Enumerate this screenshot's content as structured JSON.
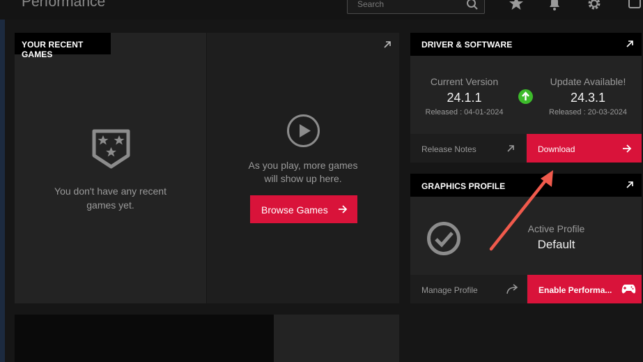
{
  "page": {
    "title": "Performance"
  },
  "search": {
    "placeholder": "Search"
  },
  "recent_games": {
    "header": "YOUR RECENT GAMES",
    "empty_text_line1": "You don't have any recent",
    "empty_text_line2": "games yet.",
    "prompt_line1": "As you play, more games",
    "prompt_line2": "will show up here.",
    "browse_label": "Browse Games"
  },
  "driver": {
    "header": "DRIVER & SOFTWARE",
    "current_label": "Current Version",
    "current_version": "24.1.1",
    "current_released": "Released : 04-01-2024",
    "update_label": "Update Available!",
    "update_version": "24.3.1",
    "update_released": "Released : 20-03-2024",
    "release_notes_label": "Release Notes",
    "download_label": "Download"
  },
  "graphics": {
    "header": "GRAPHICS PROFILE",
    "active_label": "Active Profile",
    "active_value": "Default",
    "manage_label": "Manage Profile",
    "enable_label": "Enable Performa..."
  },
  "colors": {
    "accent_red": "#d9133a",
    "update_green": "#3dbb2b",
    "annotation_arrow": "#f05a4c"
  },
  "icons": [
    "search-icon",
    "star-icon",
    "bell-icon",
    "gear-icon",
    "expand-icon",
    "play-circle-icon",
    "arrow-right-icon",
    "upload-arrow-icon",
    "check-circle-icon",
    "share-arrow-icon",
    "gamepad-icon",
    "badge-stars-icon"
  ]
}
